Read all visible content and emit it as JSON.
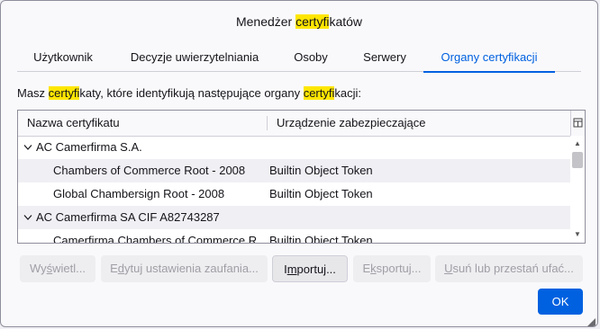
{
  "dialog": {
    "title_parts": [
      "Menedżer ",
      "certyfi",
      "katów"
    ]
  },
  "tabs": [
    {
      "label": "Użytkownik"
    },
    {
      "label": "Decyzje uwierzytelniania"
    },
    {
      "label": "Osoby"
    },
    {
      "label": "Serwery"
    },
    {
      "label": "Organy certyfikacji",
      "active": true
    }
  ],
  "description_parts": [
    "Masz ",
    "certyfi",
    "katy, które identyfikują następujące organy ",
    "certyfi",
    "kacji:"
  ],
  "table": {
    "columns": [
      "Nazwa certyfikatu",
      "Urządzenie zabezpieczające"
    ],
    "rows": [
      {
        "name": "AC Camerfirma S.A.",
        "device": "",
        "group": true
      },
      {
        "name": "Chambers of Commerce Root - 2008",
        "device": "Builtin Object Token",
        "group": false
      },
      {
        "name": "Global Chambersign Root - 2008",
        "device": "Builtin Object Token",
        "group": false
      },
      {
        "name": "AC Camerfirma SA CIF A82743287",
        "device": "",
        "group": true
      },
      {
        "name": "Camerfirma Chambers of Commerce R",
        "device": "Builtin Object Token",
        "group": false
      }
    ]
  },
  "buttons": {
    "view": {
      "pre": "Wy",
      "u": "ś",
      "post": "wietl..."
    },
    "edit_trust": {
      "pre": "E",
      "u": "d",
      "post": "ytuj ustawienia zaufania..."
    },
    "import": {
      "pre": "I",
      "u": "m",
      "post": "portuj..."
    },
    "export": {
      "pre": "E",
      "u": "k",
      "post": "sportuj..."
    },
    "delete": {
      "pre": "",
      "u": "U",
      "post": "suń lub przestań ufać..."
    },
    "ok": "OK"
  },
  "colors": {
    "accent": "#0061e0",
    "highlight": "#ffe600"
  }
}
